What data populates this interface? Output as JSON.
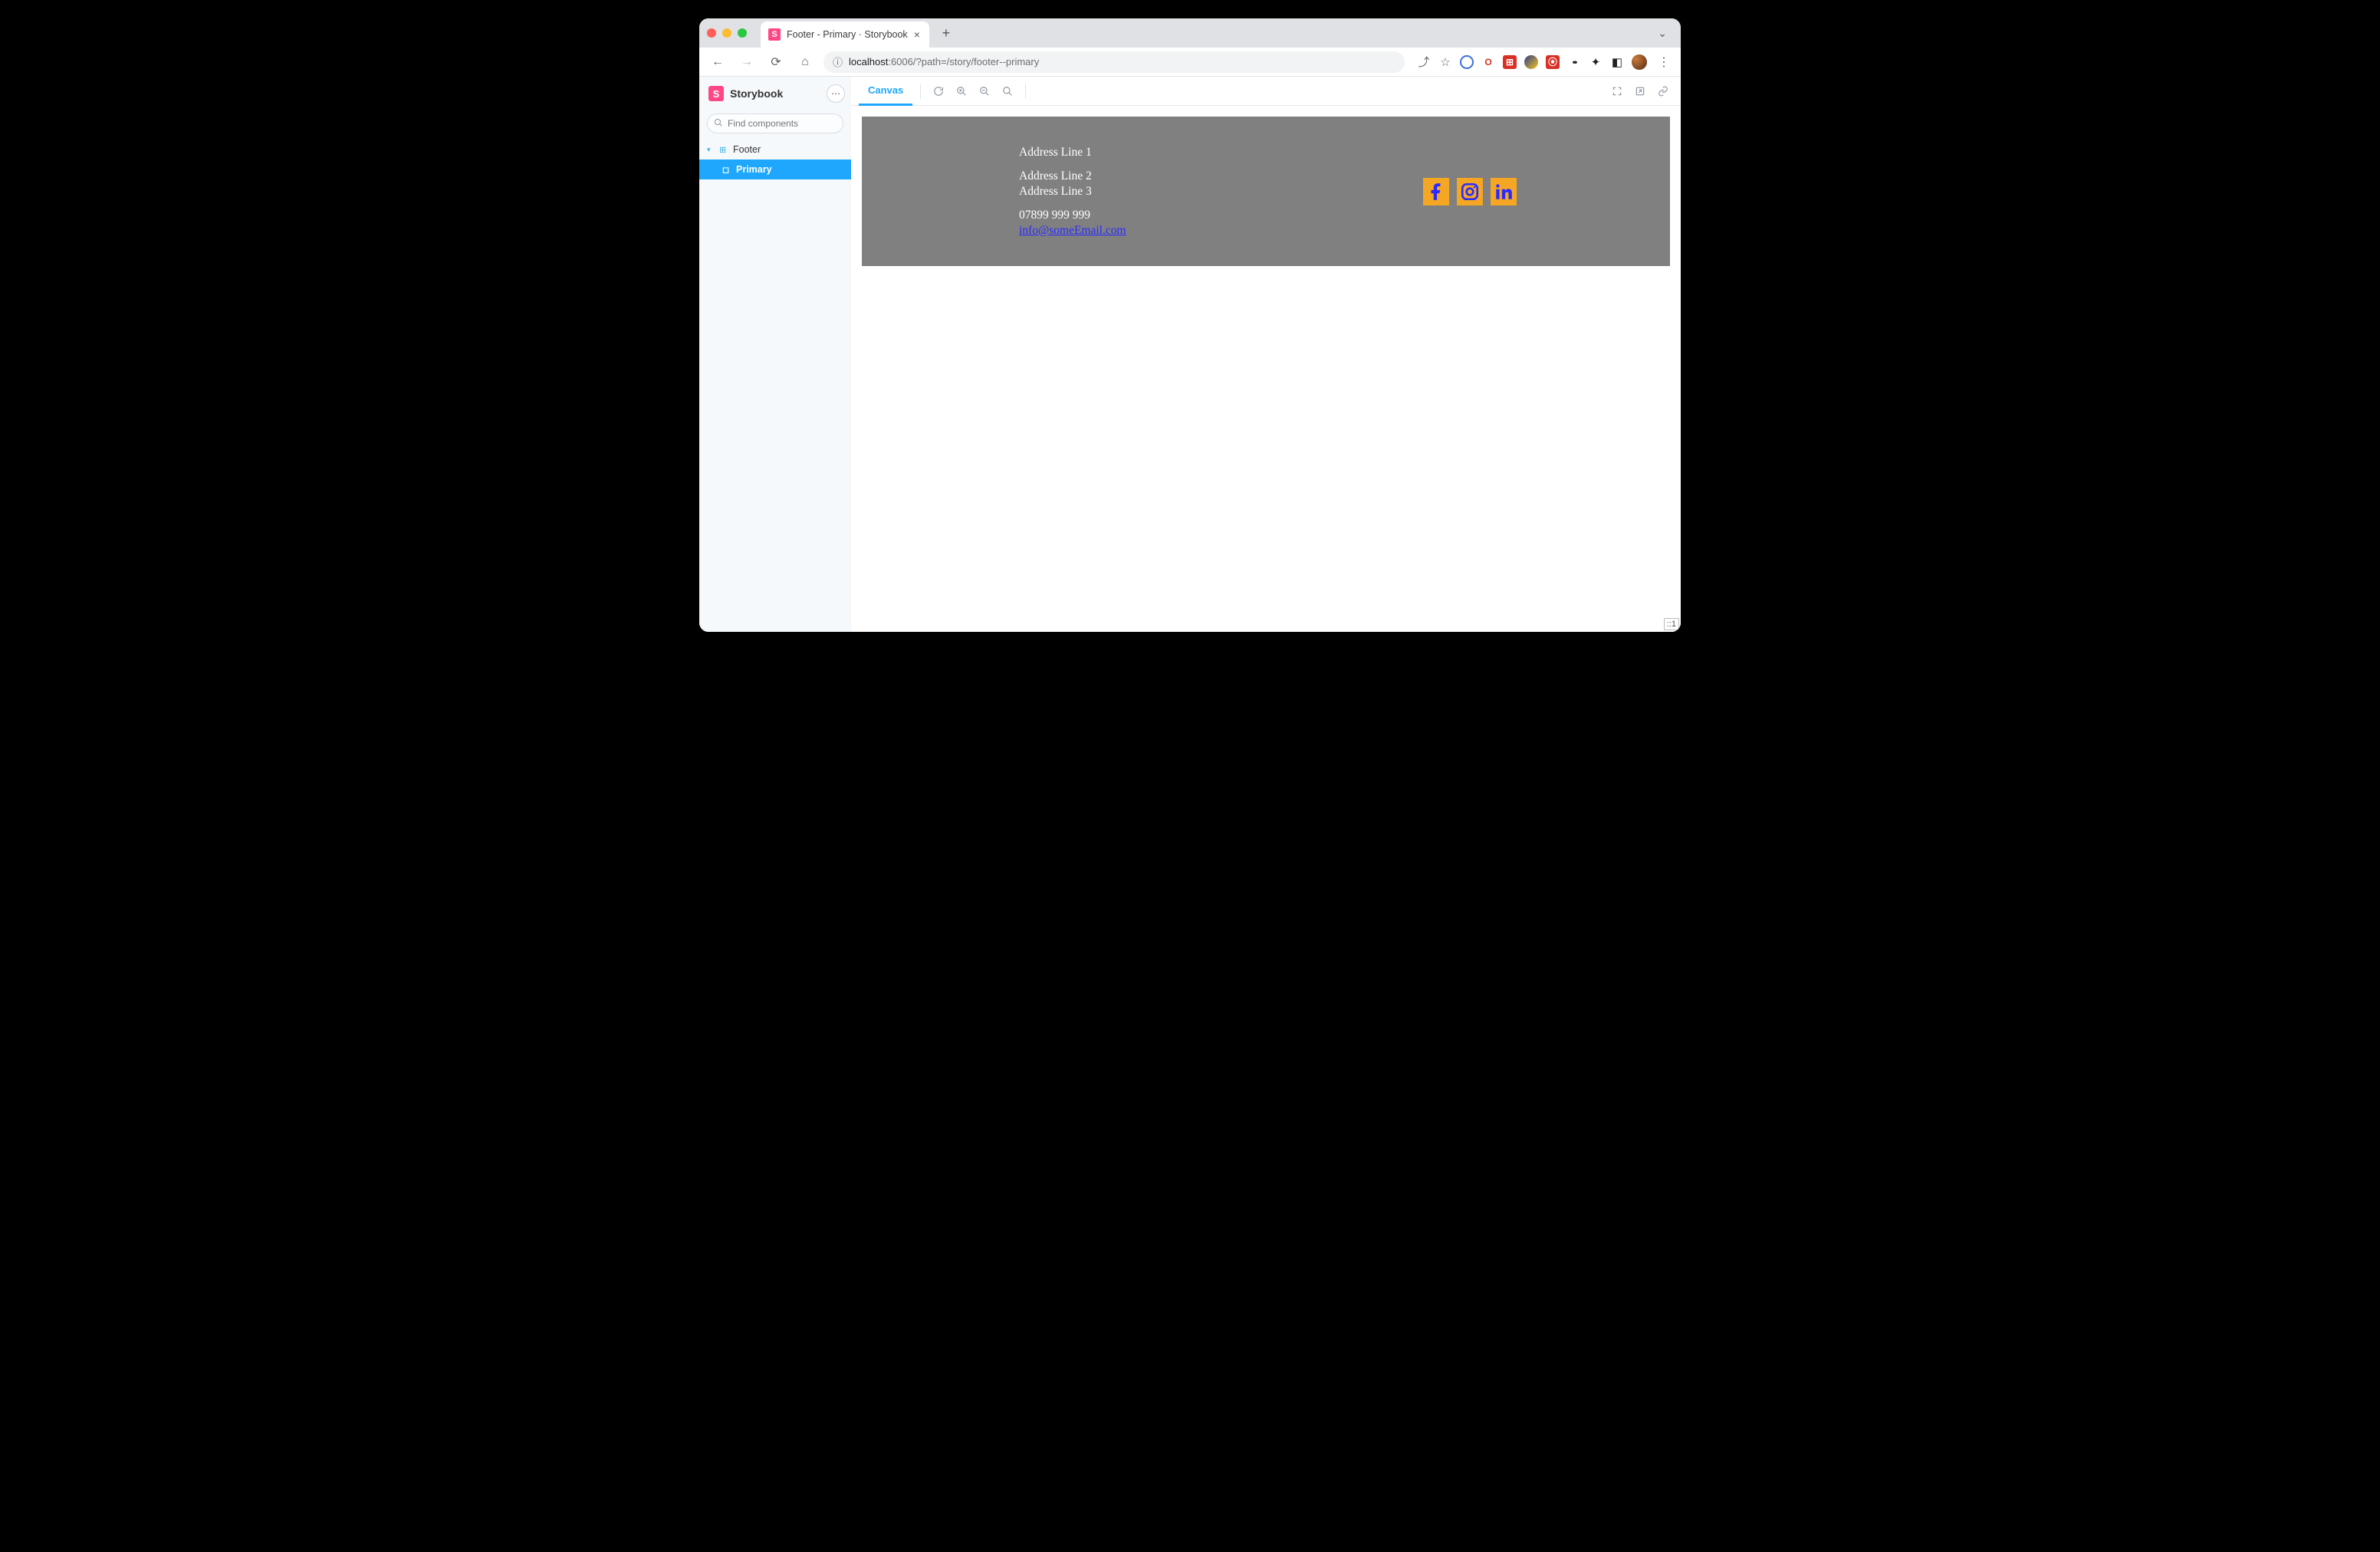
{
  "browser": {
    "tab_title": "Footer - Primary · Storybook",
    "new_tab_label": "+",
    "url_display_host": "localhost",
    "url_display_port": ":6006",
    "url_display_path": "/?path=/story/footer--primary",
    "tab_dropdown_glyph": "⌄"
  },
  "storybook": {
    "brand": "Storybook",
    "search_placeholder": "Find components",
    "search_kbd": "/",
    "toolbar_tabs": {
      "canvas": "Canvas"
    },
    "tree": {
      "component": "Footer",
      "story": "Primary"
    },
    "ip_badge": "::1"
  },
  "footer_component": {
    "address": {
      "line1": "Address Line 1",
      "line2": "Address Line 2",
      "line3": "Address Line 3"
    },
    "phone": "07899 999 999",
    "email": "info@someEmail.com",
    "social": {
      "facebook": "facebook",
      "instagram": "instagram",
      "linkedin": "linkedin"
    }
  }
}
